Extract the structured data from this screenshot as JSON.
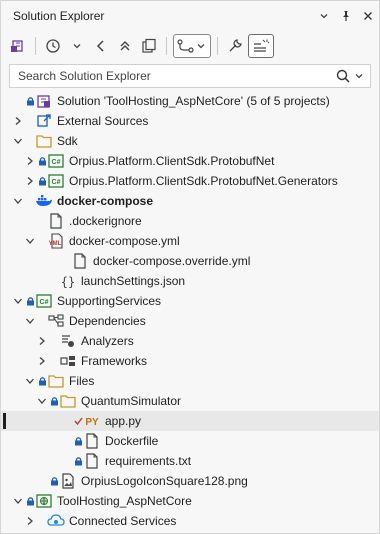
{
  "window": {
    "title": "Solution Explorer"
  },
  "search": {
    "placeholder": "Search Solution Explorer"
  },
  "tree": [
    {
      "label": "Solution 'ToolHosting_AspNetCore' (5 of 5 projects)",
      "icon": "solution-icon",
      "lock": true,
      "chevron": "none"
    },
    {
      "label": "External Sources",
      "icon": "external-sources-icon",
      "lock": false,
      "chevron": "collapsed"
    },
    {
      "label": "Sdk",
      "icon": "folder-icon",
      "lock": false,
      "chevron": "expanded"
    },
    {
      "label": "Orpius.Platform.ClientSdk.ProtobufNet",
      "icon": "csharp-project-icon",
      "lock": true,
      "chevron": "collapsed"
    },
    {
      "label": "Orpius.Platform.ClientSdk.ProtobufNet.Generators",
      "icon": "csharp-project-icon",
      "lock": true,
      "chevron": "collapsed"
    },
    {
      "label": "docker-compose",
      "icon": "docker-icon",
      "lock": false,
      "chevron": "expanded",
      "bold": true
    },
    {
      "label": ".dockerignore",
      "icon": "file-icon",
      "lock": false,
      "chevron": "none"
    },
    {
      "label": "docker-compose.yml",
      "icon": "yml-file-icon",
      "lock": false,
      "chevron": "expanded"
    },
    {
      "label": "docker-compose.override.yml",
      "icon": "file-icon",
      "lock": false,
      "chevron": "none"
    },
    {
      "label": "launchSettings.json",
      "icon": "json-file-icon",
      "lock": false,
      "chevron": "none"
    },
    {
      "label": "SupportingServices",
      "icon": "csharp-project-icon",
      "lock": true,
      "chevron": "expanded"
    },
    {
      "label": "Dependencies",
      "icon": "dependencies-icon",
      "lock": false,
      "chevron": "expanded"
    },
    {
      "label": "Analyzers",
      "icon": "analyzers-icon",
      "lock": false,
      "chevron": "collapsed"
    },
    {
      "label": "Frameworks",
      "icon": "frameworks-icon",
      "lock": false,
      "chevron": "collapsed"
    },
    {
      "label": "Files",
      "icon": "folder-icon",
      "lock": true,
      "chevron": "expanded"
    },
    {
      "label": "QuantumSimulator",
      "icon": "folder-icon",
      "lock": true,
      "chevron": "expanded"
    },
    {
      "label": "app.py",
      "icon": "python-file-icon",
      "lock": false,
      "checkmark": true,
      "chevron": "none",
      "selected": true
    },
    {
      "label": "Dockerfile",
      "icon": "file-icon",
      "lock": true,
      "chevron": "none"
    },
    {
      "label": "requirements.txt",
      "icon": "file-icon",
      "lock": true,
      "chevron": "none"
    },
    {
      "label": "OrpiusLogoIconSquare128.png",
      "icon": "image-file-icon",
      "lock": true,
      "chevron": "none"
    },
    {
      "label": "ToolHosting_AspNetCore",
      "icon": "web-project-icon",
      "lock": true,
      "chevron": "expanded"
    },
    {
      "label": "Connected Services",
      "icon": "connected-services-icon",
      "lock": false,
      "chevron": "collapsed"
    }
  ],
  "colors": {
    "accent_green": "#2e7d32",
    "lock_blue": "#1f5fb4",
    "folder_yellow": "#c59a2c",
    "py_orange": "#c4700a"
  }
}
